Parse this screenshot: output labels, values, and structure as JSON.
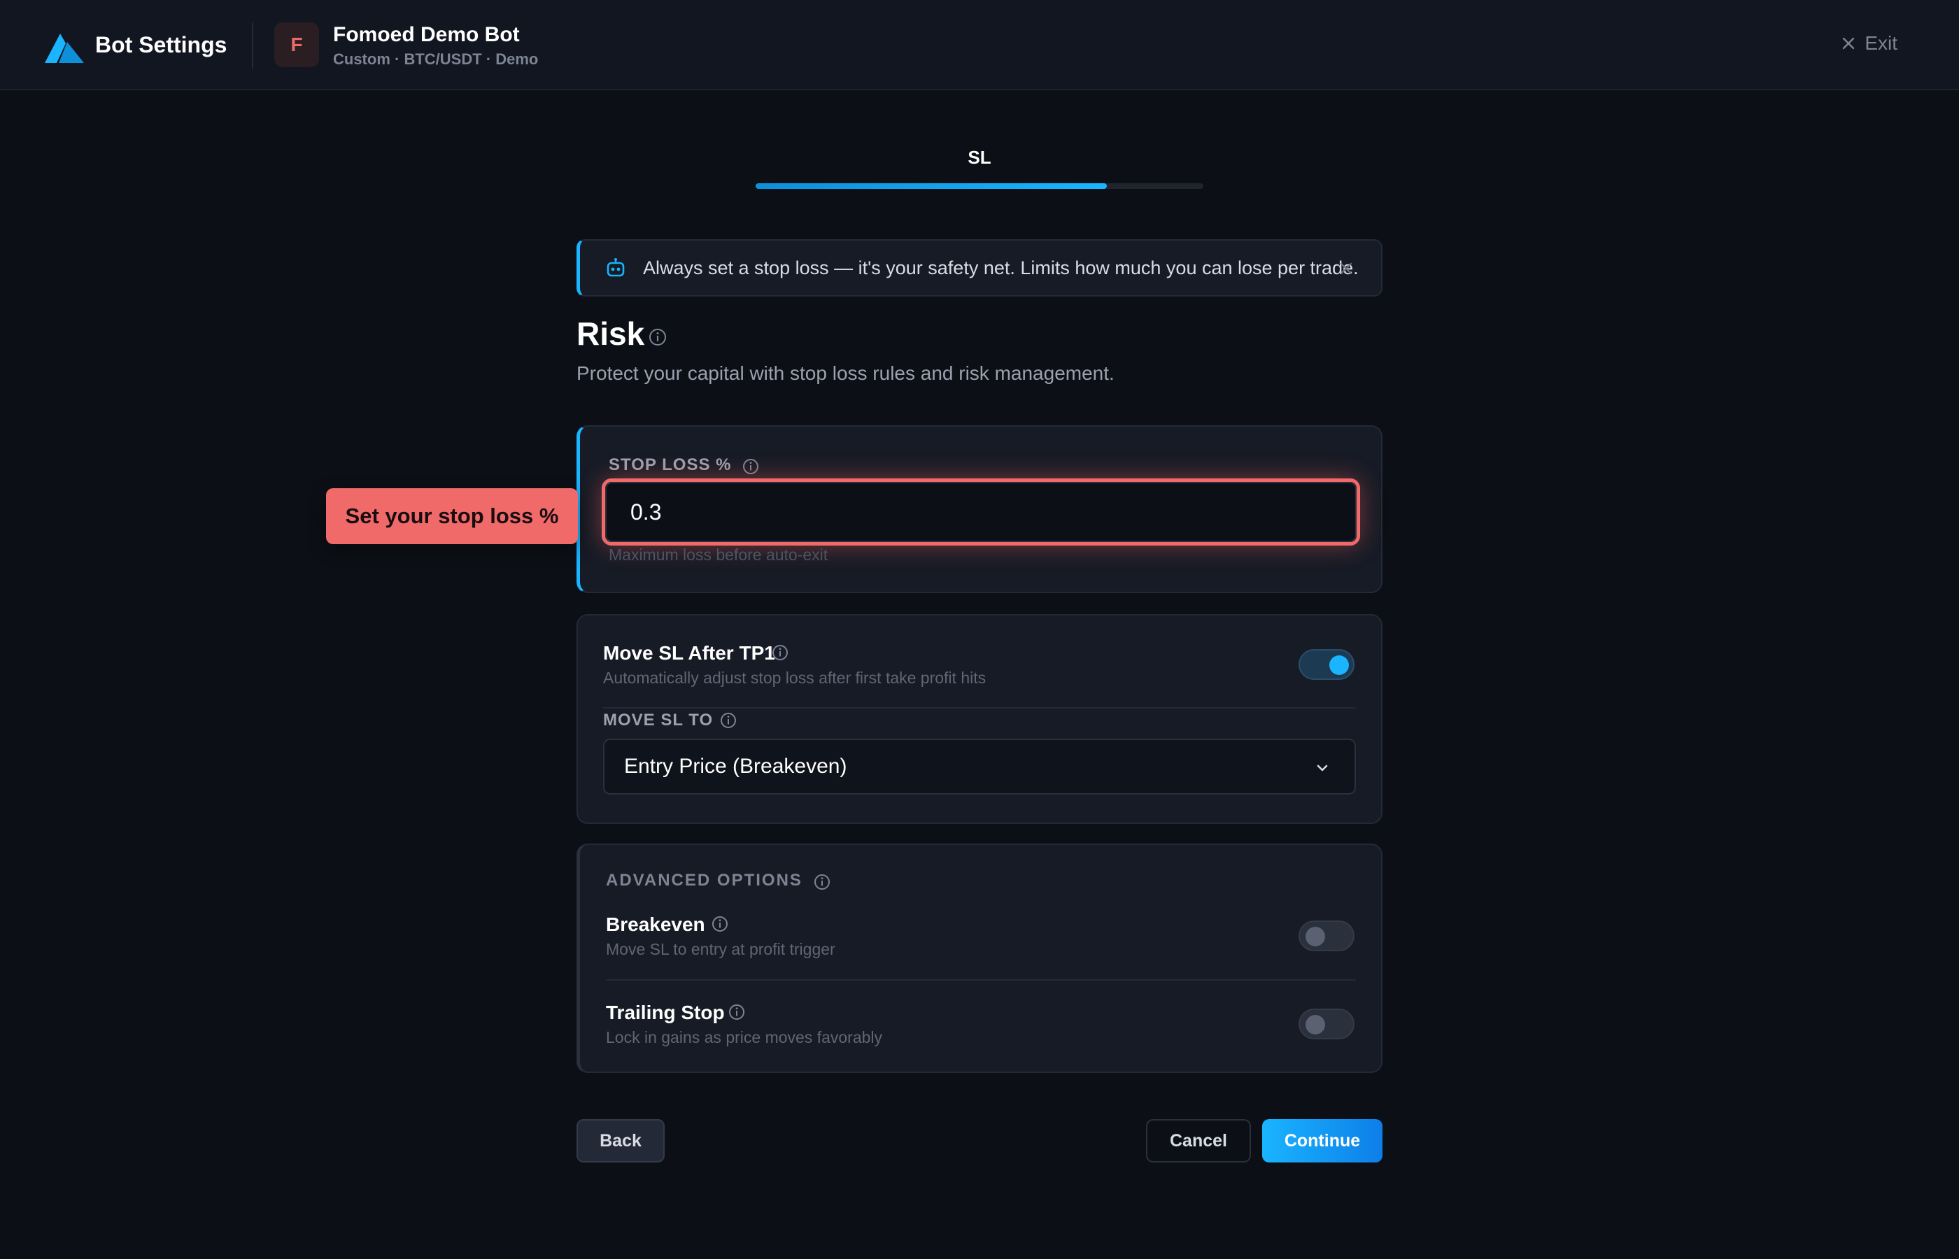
{
  "header": {
    "app_title": "Bot Settings",
    "bot_initial": "F",
    "bot_name": "Fomoed Demo Bot",
    "bot_subtitle": "Custom · BTC/USDT · Demo",
    "exit_label": "Exit",
    "logo_icon": "logo-mountain-icon",
    "exit_icon": "close-icon"
  },
  "step": {
    "label": "SL",
    "progress": 0.785
  },
  "tip": {
    "icon": "robot-icon",
    "text": "Always set a stop loss — it's your safety net. Limits how much you can lose per trade.",
    "close_icon": "close-icon"
  },
  "section": {
    "title": "Risk",
    "description": "Protect your capital with stop loss rules and risk management."
  },
  "stop_loss": {
    "label": "STOP LOSS %",
    "value": "0.3",
    "hint": "Maximum loss before auto-exit",
    "callout": "Set your stop loss %"
  },
  "move_sl": {
    "title": "Move SL After TP1",
    "description": "Automatically adjust stop loss after first take profit hits",
    "enabled": true,
    "to_label": "MOVE SL TO",
    "selected": "Entry Price (Breakeven)"
  },
  "advanced": {
    "label": "ADVANCED OPTIONS",
    "breakeven": {
      "title": "Breakeven",
      "description": "Move SL to entry at profit trigger",
      "enabled": false
    },
    "trailing_stop": {
      "title": "Trailing Stop",
      "description": "Lock in gains as price moves favorably",
      "enabled": false
    }
  },
  "footer": {
    "back_label": "Back",
    "cancel_label": "Cancel",
    "continue_label": "Continue"
  },
  "colors": {
    "accent": "#1ab4ff",
    "highlight": "#f06a6a",
    "background": "#0c0f15",
    "card": "#161b25"
  }
}
